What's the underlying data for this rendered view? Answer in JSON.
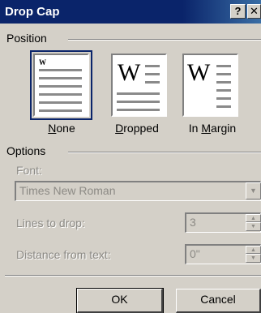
{
  "window": {
    "title": "Drop Cap",
    "help_glyph": "?",
    "close_glyph": "✕"
  },
  "position": {
    "group_label": "Position",
    "options": [
      {
        "label": "None",
        "mnemonic": "N",
        "rest": "one",
        "selected": true
      },
      {
        "label": "Dropped",
        "mnemonic": "D",
        "rest": "ropped",
        "selected": false
      },
      {
        "label": "In Margin",
        "prefix": "In ",
        "mnemonic": "M",
        "rest": "argin",
        "selected": false
      }
    ],
    "preview_letter": "W"
  },
  "options": {
    "group_label": "Options",
    "font_label": "Font:",
    "font_value": "Times New Roman",
    "lines_label": "Lines to drop:",
    "lines_value": "3",
    "distance_label": "Distance from text:",
    "distance_value": "0\""
  },
  "buttons": {
    "ok": "OK",
    "cancel": "Cancel"
  },
  "colors": {
    "title_bar": "#0a246a",
    "face": "#d4d0c8",
    "disabled_text": "#8c8a85"
  }
}
